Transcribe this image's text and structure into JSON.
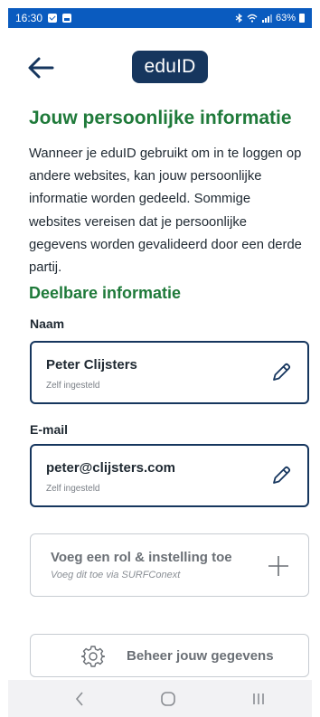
{
  "status_bar": {
    "time": "16:30",
    "battery": "63%"
  },
  "header": {
    "back_icon": "arrow-left-icon",
    "logo_text": "eduID"
  },
  "page": {
    "title": "Jouw persoonlijke informatie",
    "intro": "Wanneer je eduID gebruikt om in te loggen op andere websites, kan jouw persoonlijke informatie worden gedeeld. Sommige websites vereisen dat je persoonlijke gegevens worden gevalideerd door een derde partij.",
    "section_title": "Deelbare informatie"
  },
  "fields": {
    "name": {
      "label": "Naam",
      "value": "Peter Clijsters",
      "note": "Zelf ingesteld"
    },
    "email": {
      "label": "E-mail",
      "value": "peter@clijsters.com",
      "note": "Zelf ingesteld"
    }
  },
  "add_role": {
    "title": "Voeg een rol & instelling toe",
    "subtitle": "Voeg dit toe via SURFConext"
  },
  "manage": {
    "label": "Beheer jouw gegevens"
  },
  "colors": {
    "status_bar": "#0a5bbf",
    "primary_dark": "#16365e",
    "heading_green": "#1f7a3a"
  }
}
